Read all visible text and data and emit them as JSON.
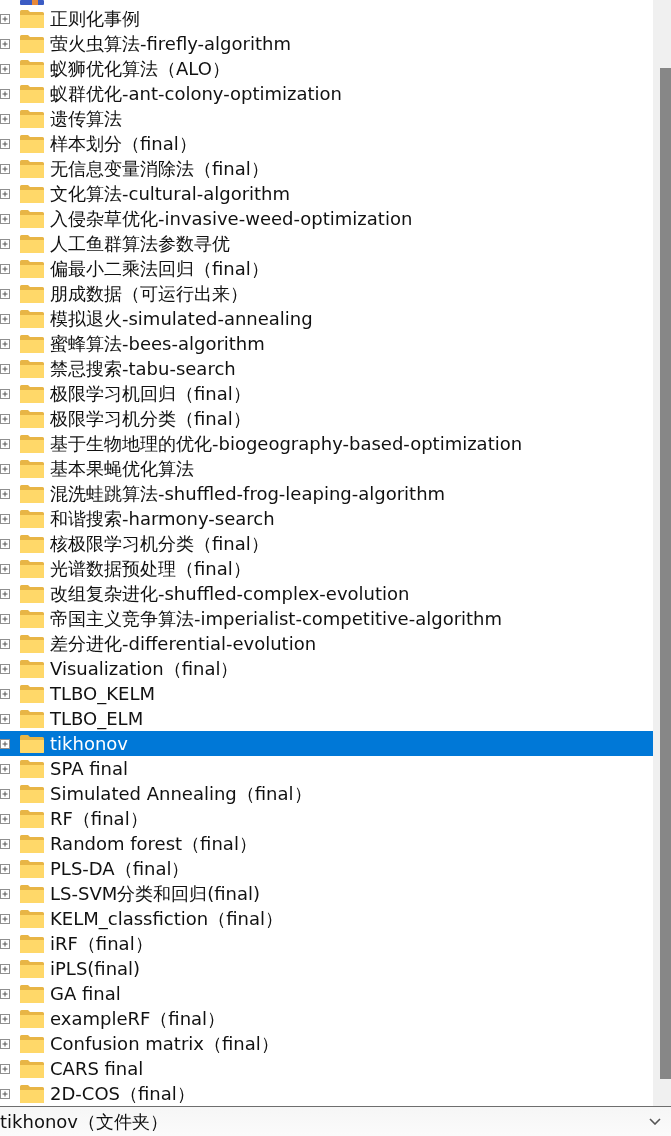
{
  "tree": {
    "items": [
      {
        "label": "正则化事例",
        "expanded": false,
        "selected": false
      },
      {
        "label": "萤火虫算法-firefly-algorithm",
        "expanded": false,
        "selected": false
      },
      {
        "label": "蚁狮优化算法（ALO）",
        "expanded": false,
        "selected": false
      },
      {
        "label": "蚁群优化-ant-colony-optimization",
        "expanded": false,
        "selected": false
      },
      {
        "label": "遗传算法",
        "expanded": false,
        "selected": false
      },
      {
        "label": "样本划分（final）",
        "expanded": false,
        "selected": false
      },
      {
        "label": "无信息变量消除法（final）",
        "expanded": false,
        "selected": false
      },
      {
        "label": "文化算法-cultural-algorithm",
        "expanded": false,
        "selected": false
      },
      {
        "label": "入侵杂草优化-invasive-weed-optimization",
        "expanded": false,
        "selected": false
      },
      {
        "label": "人工鱼群算法参数寻优",
        "expanded": false,
        "selected": false
      },
      {
        "label": "偏最小二乘法回归（final）",
        "expanded": false,
        "selected": false
      },
      {
        "label": "朋成数据（可运行出来）",
        "expanded": false,
        "selected": false
      },
      {
        "label": "模拟退火-simulated-annealing",
        "expanded": false,
        "selected": false
      },
      {
        "label": "蜜蜂算法-bees-algorithm",
        "expanded": false,
        "selected": false
      },
      {
        "label": "禁忌搜索-tabu-search",
        "expanded": false,
        "selected": false
      },
      {
        "label": "极限学习机回归（final）",
        "expanded": false,
        "selected": false
      },
      {
        "label": "极限学习机分类（final）",
        "expanded": false,
        "selected": false
      },
      {
        "label": "基于生物地理的优化-biogeography-based-optimization",
        "expanded": false,
        "selected": false
      },
      {
        "label": "基本果蝇优化算法",
        "expanded": false,
        "selected": false
      },
      {
        "label": "混洗蛙跳算法-shuffled-frog-leaping-algorithm",
        "expanded": false,
        "selected": false
      },
      {
        "label": "和谐搜索-harmony-search",
        "expanded": false,
        "selected": false
      },
      {
        "label": "核极限学习机分类（final）",
        "expanded": false,
        "selected": false
      },
      {
        "label": "光谱数据预处理（final）",
        "expanded": false,
        "selected": false
      },
      {
        "label": "改组复杂进化-shuffled-complex-evolution",
        "expanded": false,
        "selected": false
      },
      {
        "label": "帝国主义竞争算法-imperialist-competitive-algorithm",
        "expanded": false,
        "selected": false
      },
      {
        "label": "差分进化-differential-evolution",
        "expanded": false,
        "selected": false
      },
      {
        "label": "Visualization（final）",
        "expanded": false,
        "selected": false
      },
      {
        "label": "TLBO_KELM",
        "expanded": false,
        "selected": false
      },
      {
        "label": "TLBO_ELM",
        "expanded": false,
        "selected": false
      },
      {
        "label": "tikhonov",
        "expanded": false,
        "selected": true
      },
      {
        "label": "SPA final",
        "expanded": false,
        "selected": false
      },
      {
        "label": "Simulated Annealing（final）",
        "expanded": false,
        "selected": false
      },
      {
        "label": "RF（final）",
        "expanded": false,
        "selected": false
      },
      {
        "label": "Random forest（final）",
        "expanded": false,
        "selected": false
      },
      {
        "label": "PLS-DA（final）",
        "expanded": false,
        "selected": false
      },
      {
        "label": "LS-SVM分类和回归(final)",
        "expanded": false,
        "selected": false
      },
      {
        "label": "KELM_classfiction（final）",
        "expanded": false,
        "selected": false
      },
      {
        "label": "iRF（final）",
        "expanded": false,
        "selected": false
      },
      {
        "label": "iPLS(final)",
        "expanded": false,
        "selected": false
      },
      {
        "label": "GA final",
        "expanded": false,
        "selected": false
      },
      {
        "label": "exampleRF（final）",
        "expanded": false,
        "selected": false
      },
      {
        "label": "Confusion matrix（final）",
        "expanded": false,
        "selected": false
      },
      {
        "label": "CARS final",
        "expanded": false,
        "selected": false
      },
      {
        "label": "2D-COS（final）",
        "expanded": false,
        "selected": false
      }
    ]
  },
  "status_bar": {
    "text": "tikhonov（文件夹）"
  }
}
